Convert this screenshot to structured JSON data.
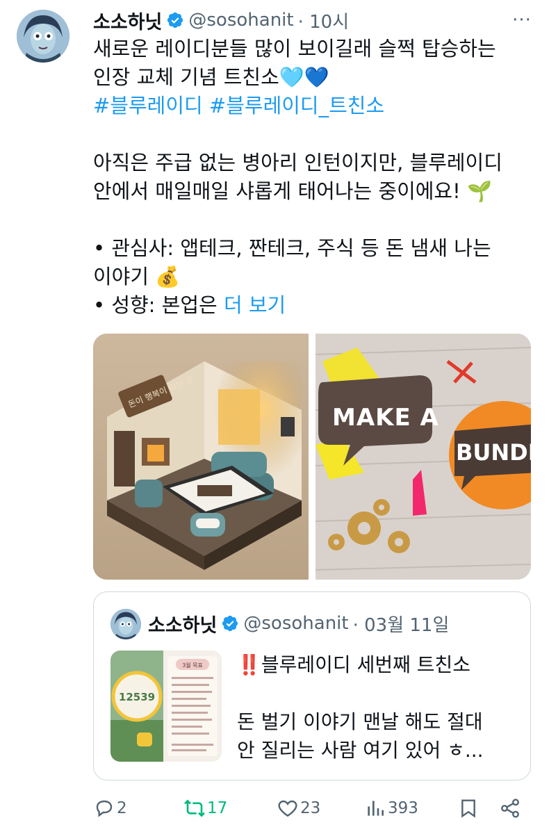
{
  "tweet": {
    "author_name": "소소하닛",
    "handle": "@sosohanit",
    "time": "· 10시",
    "text_lines": [
      "새로운 레이디분들 많이 보이길래 슬쩍 탑승하는",
      "인장 교체 기념 트친소🩵💙"
    ],
    "hashtags": "#블루레이디 #블루레이디_트친소",
    "para2_lines": [
      "아직은 주급 없는 병아리 인턴이지만, 블루레이디",
      "안에서 매일매일 샤롭게 태어나는 중이에요! 🌱"
    ],
    "bullet1_lines": [
      "• 관심사: 앱테크, 짠테크, 주식 등 돈 냄새 나는",
      "이야기 💰"
    ],
    "bullet2_prefix": "• 성향: 본업은 ",
    "more_label": "더 보기"
  },
  "media": {
    "left_sign": "돈이 행복이 되는 곳",
    "right_text_1": "MAKE A",
    "right_text_2": "BUNDLE"
  },
  "quote": {
    "author_name": "소소하닛",
    "handle": "@sosohanit",
    "time": "· 03월 11일",
    "title": "‼️블루레이디 세번째 트친소",
    "lines": [
      "돈 벌기 이야기 맨날 해도 절대",
      "안 질리는 사람 여기 있어 ㅎ..."
    ],
    "thumb_steps": "12539",
    "thumb_header": "3월 목표"
  },
  "actions": {
    "reply_count": "2",
    "retweet_count": "17",
    "like_count": "23",
    "views_count": "393"
  },
  "colors": {
    "accent": "#1d9bf0",
    "secondary_text": "#536471",
    "retweet_green": "#00ba7c"
  }
}
